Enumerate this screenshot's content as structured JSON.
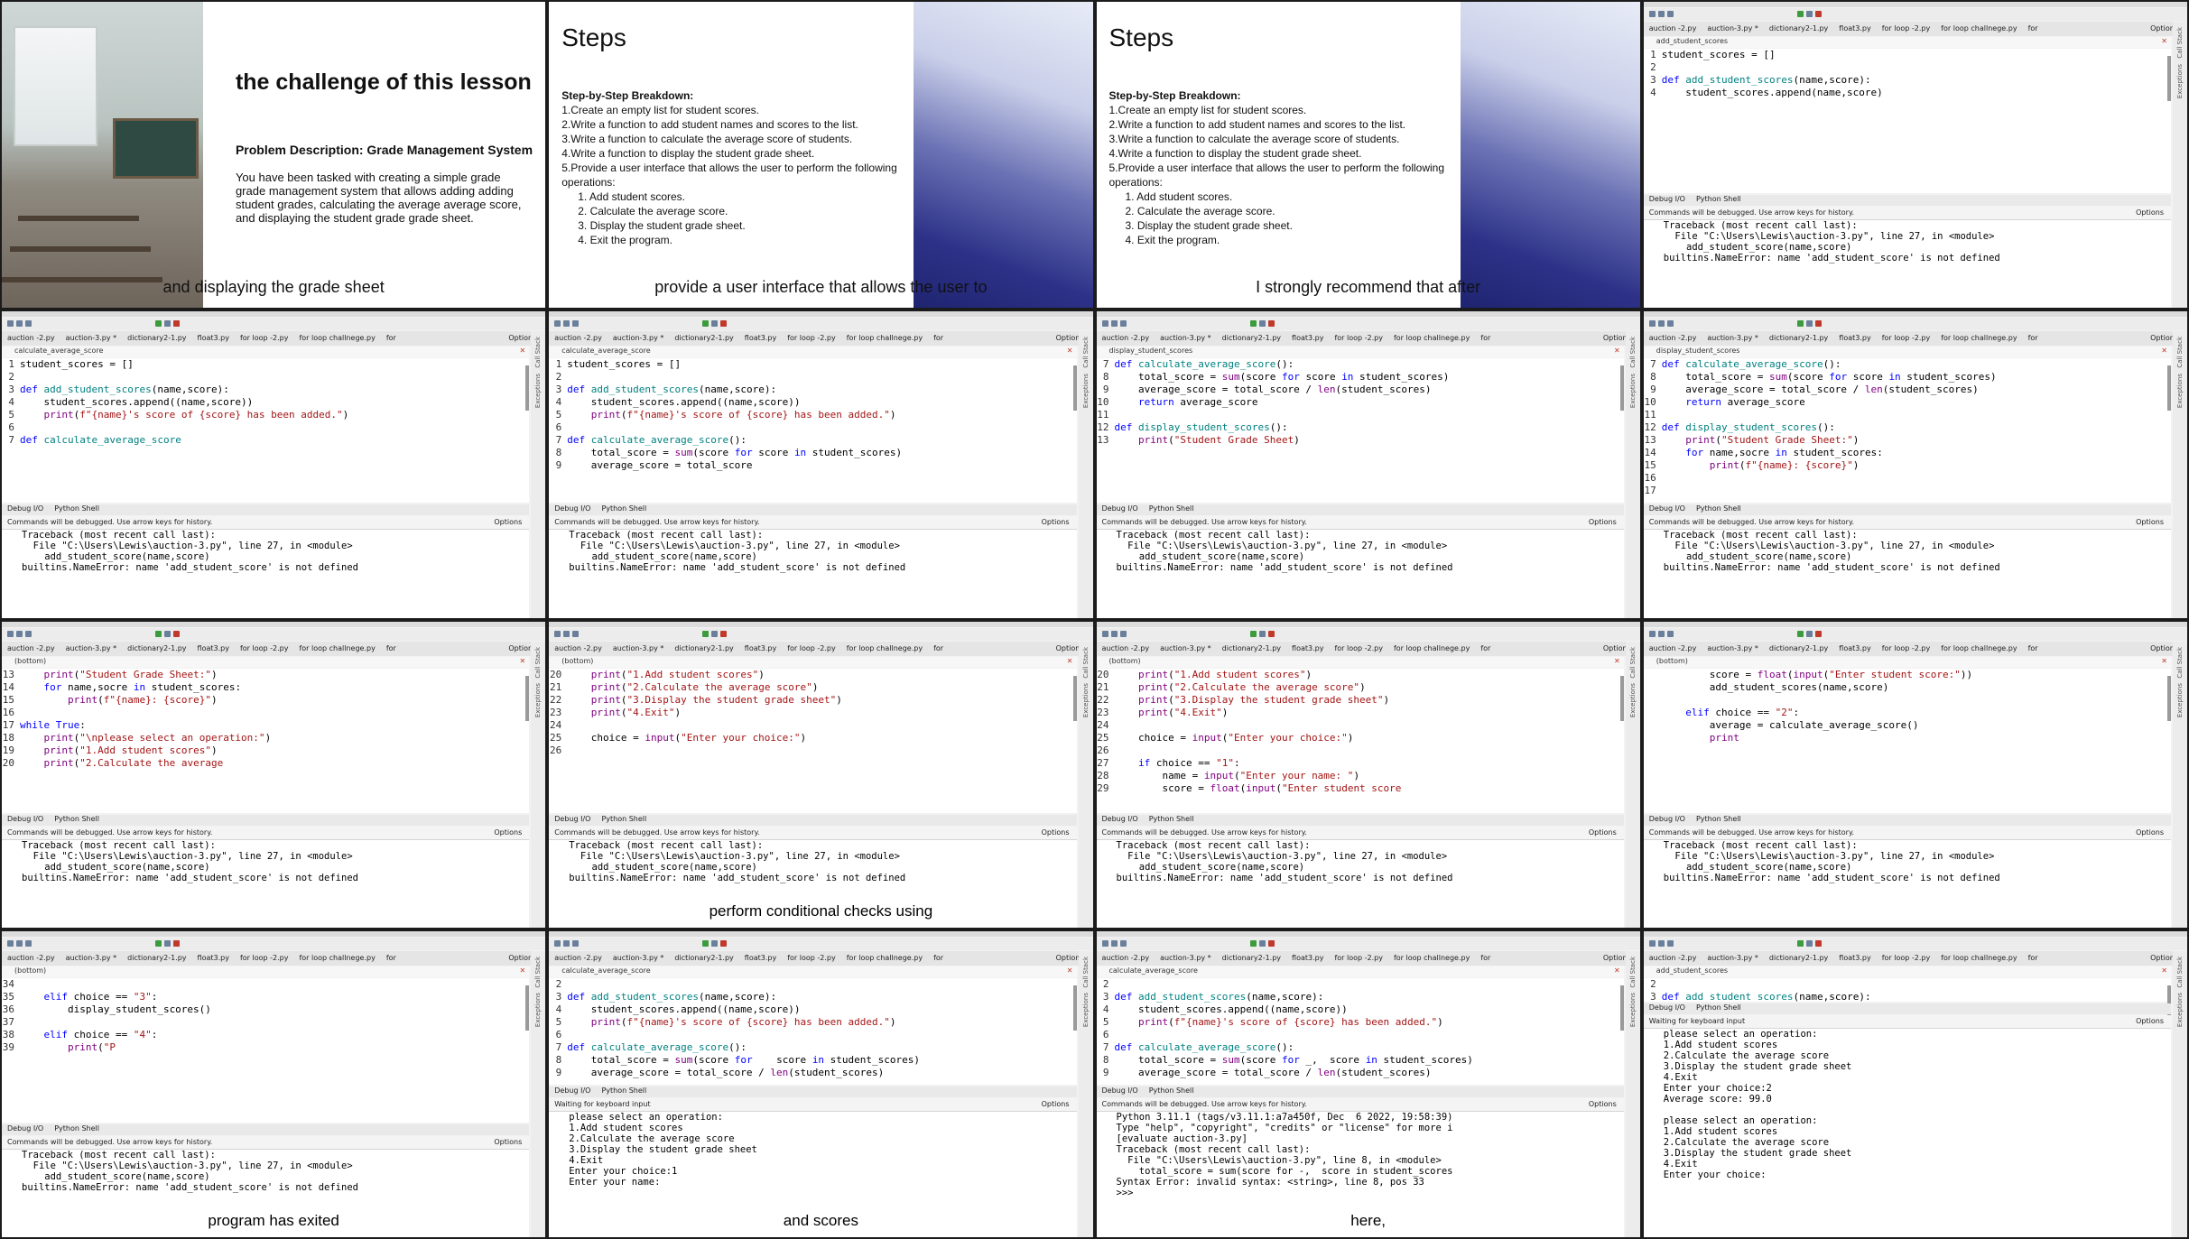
{
  "slide1": {
    "title": "the challenge of this lesson",
    "subtitle": "Problem Description: Grade Management System",
    "body": "You have been tasked with creating a simple grade grade management system that allows adding adding student grades, calculating the average average score, and displaying the student grade grade sheet.",
    "caption": "and displaying the grade sheet"
  },
  "steps": {
    "title": "Steps",
    "heading": "Step-by-Step Breakdown:",
    "items": [
      "1.Create an empty list for student scores.",
      "2.Write a function to add student names and scores to the list.",
      "3.Write a function to calculate the average score of students.",
      "4.Write a function to display the student grade sheet.",
      "5.Provide a user interface that allows the user to perform the following operations:"
    ],
    "subitems": [
      "1. Add student scores.",
      "2. Calculate the average score.",
      "3. Display the student grade sheet.",
      "4. Exit the program."
    ],
    "caption_a": "provide a user interface that allows the user to",
    "caption_b": "I strongly recommend that after"
  },
  "ide": {
    "tabs": [
      "auction -2.py",
      "auction-3.py *",
      "dictionary2-1.py",
      "float3.py",
      "for loop -2.py",
      "for loop challnege.py",
      "for"
    ],
    "options_label": "Options",
    "panel_tabs": [
      "Debug I/O",
      "Python Shell"
    ],
    "hint": "Commands will be debugged.  Use arrow keys for history.",
    "hint_waiting": "Waiting for keyboard input",
    "side_labels": [
      "Call Stack",
      "Exceptions"
    ],
    "traceback": "Traceback (most recent call last):\n  File \"C:\\Users\\Lewis\\auction-3.py\", line 27, in <module>\n    add_student_score(name,score)\nbuiltins.NameError: name 'add_student_score' is not defined",
    "captions": {
      "conditional": "perform conditional checks using",
      "exited": "program has exited",
      "scores": "and scores",
      "here": "here,"
    },
    "shell_run1": "please select an operation:\n1.Add student scores\n2.Calculate the average score\n3.Display the student grade sheet\n4.Exit\nEnter your choice:1\nEnter your name:",
    "shell_error": "Python 3.11.1 (tags/v3.11.1:a7a450f, Dec  6 2022, 19:58:39)\nType \"help\", \"copyright\", \"credits\" or \"license\" for more i\n[evaluate auction-3.py]\nTraceback (most recent call last):\n  File \"C:\\Users\\Lewis\\auction-3.py\", line 8, in <module>\n    total_score = sum(score for -,  score in student_scores\nSyntax Error: invalid syntax: <string>, line 8, pos 33\n>>>",
    "shell_run2": "please select an operation:\n1.Add student scores\n2.Calculate the average score\n3.Display the student grade sheet\n4.Exit\nEnter your choice:2\nAverage score: 99.0\n\nplease select an operation:\n1.Add student scores\n2.Calculate the average score\n3.Display the student grade sheet\n4.Exit\nEnter your choice:"
  },
  "files": {
    "add": "add_student_scores",
    "calc": "calculate_average_score",
    "disp": "display_student_scores",
    "bottom": "(bottom)"
  }
}
